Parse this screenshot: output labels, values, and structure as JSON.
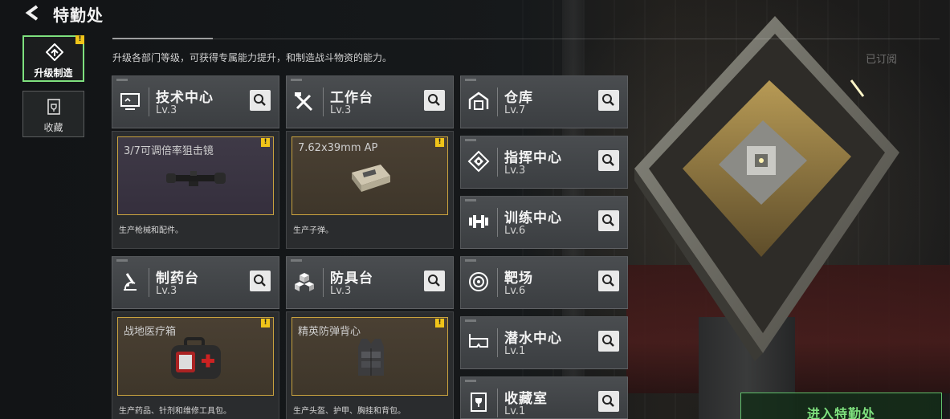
{
  "header": {
    "title": "特勤处",
    "subtitle": "升级各部门等级，可获得专属能力提升，和制造战斗物资的能力。",
    "subscribed_label": "已订阅"
  },
  "side_tabs": [
    {
      "label": "升级制造",
      "icon": "upgrade-icon",
      "active": true,
      "alert": "!"
    },
    {
      "label": "收藏",
      "icon": "collection-icon",
      "active": false
    }
  ],
  "departments": [
    {
      "name": "技术中心",
      "level": "Lv.3",
      "icon": "monitor-icon"
    },
    {
      "name": "工作台",
      "level": "Lv.3",
      "icon": "tools-icon"
    },
    {
      "name": "制药台",
      "level": "Lv.3",
      "icon": "microscope-icon"
    },
    {
      "name": "防具台",
      "level": "Lv.3",
      "icon": "cubes-icon"
    },
    {
      "name": "仓库",
      "level": "Lv.7",
      "icon": "warehouse-icon"
    },
    {
      "name": "指挥中心",
      "level": "Lv.3",
      "icon": "command-icon"
    },
    {
      "name": "训练中心",
      "level": "Lv.6",
      "icon": "dumbbell-icon"
    },
    {
      "name": "靶场",
      "level": "Lv.6",
      "icon": "target-icon"
    },
    {
      "name": "潜水中心",
      "level": "Lv.1",
      "icon": "diving-mask-icon"
    },
    {
      "name": "收藏室",
      "level": "Lv.1",
      "icon": "trophy-icon"
    }
  ],
  "production": [
    {
      "item": "3/7可调倍率狙击镜",
      "desc": "生产枪械和配件。",
      "alert": "!",
      "image": "scope-image"
    },
    {
      "item": "7.62x39mm AP",
      "desc": "生产子弹。",
      "alert": "!",
      "image": "ammo-box-image"
    },
    {
      "item": "战地医疗箱",
      "desc": "生产药品、针剂和维修工具包。",
      "alert": "!",
      "image": "medkit-image"
    },
    {
      "item": "精英防弹背心",
      "desc": "生产头盔、护甲、胸挂和背包。",
      "alert": "!",
      "image": "vest-image"
    }
  ],
  "enter_button": {
    "label": "进入特勤处"
  },
  "colors": {
    "accent_green": "#7ee07e",
    "alert_yellow": "#f0c419",
    "item_border_gold": "#c9a23e"
  }
}
